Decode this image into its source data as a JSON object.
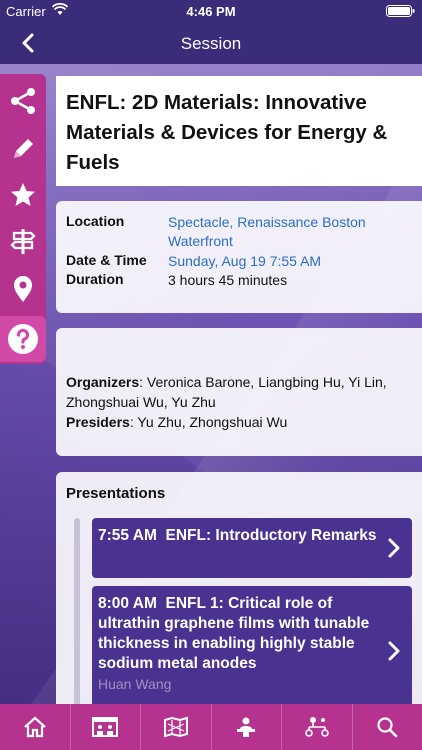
{
  "status_bar": {
    "carrier": "Carrier",
    "time": "4:46 PM"
  },
  "header": {
    "title": "Session"
  },
  "session": {
    "title": "ENFL: 2D Materials: Innovative Materials & Devices for Energy & Fuels"
  },
  "details": {
    "location_label": "Location",
    "location_value": "Spectacle, Renaissance Boston Waterfront",
    "datetime_label": "Date & Time",
    "datetime_value": "Sunday, Aug 19 7:55 AM",
    "duration_label": "Duration",
    "duration_value": "3 hours 45 minutes"
  },
  "people": {
    "organizers_label": "Organizers",
    "organizers_value": ": Veronica Barone, Liangbing Hu, Yi Lin, Zhongshuai Wu, Yu Zhu",
    "presiders_label": "Presiders",
    "presiders_value": ": Yu Zhu, Zhongshuai Wu"
  },
  "presentations": {
    "heading": "Presentations",
    "items": [
      {
        "time": "7:55 AM",
        "title": "ENFL: Introductory Remarks",
        "speaker": ""
      },
      {
        "time": "8:00 AM",
        "title": "ENFL 1: Critical role of ultrathin graphene films with tunable thickness in enabling highly stable sodium metal anodes",
        "speaker": "Huan Wang"
      }
    ]
  },
  "rail_icons": [
    "share-icon",
    "pencil-icon",
    "star-icon",
    "signpost-icon",
    "map-pin-icon",
    "help-icon"
  ],
  "tab_icons": [
    "home-icon",
    "exhibition-icon",
    "floor-map-icon",
    "speaker-icon",
    "org-chart-icon",
    "search-icon"
  ],
  "colors": {
    "header": "#3a2c78",
    "accent": "#b5338f",
    "presentation_item": "#4a3390",
    "link": "#2a6fc2"
  }
}
